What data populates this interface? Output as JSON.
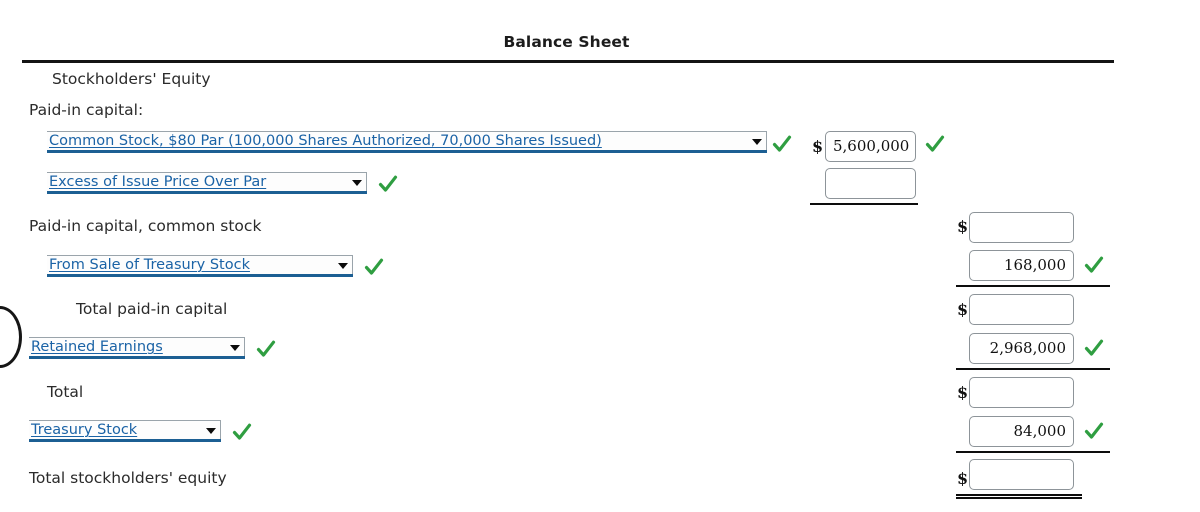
{
  "header": {
    "title": "Balance Sheet"
  },
  "labels": {
    "stockholders_equity": "Stockholders' Equity",
    "paid_in_capital": "Paid-in capital:",
    "paid_in_capital_common_stock": "Paid-in capital, common stock",
    "total_paid_in_capital": "Total paid-in capital",
    "total": "Total",
    "total_stockholders_equity": "Total stockholders' equity"
  },
  "dropdowns": [
    {
      "name": "common-stock",
      "value": "Common Stock, $80 Par (100,000 Shares Authorized, 70,000 Shares Issued)",
      "validated": true
    },
    {
      "name": "excess-of-issue-price-over-par",
      "value": "Excess of Issue Price Over Par",
      "validated": true
    },
    {
      "name": "from-sale-of-treasury-stock",
      "value": "From Sale of Treasury Stock",
      "validated": true
    },
    {
      "name": "retained-earnings",
      "value": "Retained Earnings",
      "validated": true
    },
    {
      "name": "treasury-stock",
      "value": "Treasury Stock",
      "validated": true
    }
  ],
  "amounts": {
    "common_stock": "5,600,000",
    "excess_of_issue_price_over_par": "",
    "paid_in_capital_common_stock": "",
    "from_sale_of_treasury_stock": "168,000",
    "total_paid_in_capital": "",
    "retained_earnings": "2,968,000",
    "total": "",
    "treasury_stock": "84,000",
    "total_stockholders_equity": ""
  },
  "currency_symbol": "$",
  "icons": {
    "check": "check-icon",
    "caret": "chevron-down-icon"
  },
  "colors": {
    "link": "#1b63a6",
    "select_underline": "#1c5f93",
    "check": "#2f9e41",
    "rule": "#0d0d0d",
    "text": "#2b2b2b"
  }
}
